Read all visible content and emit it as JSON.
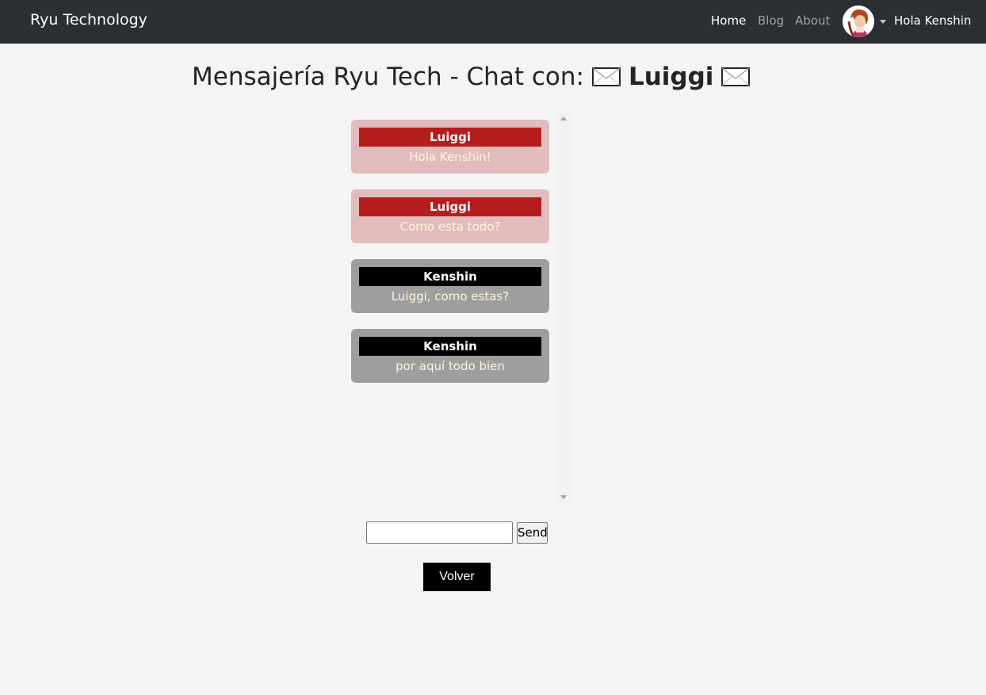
{
  "navbar": {
    "brand": "Ryu Technology",
    "links": [
      {
        "label": "Home",
        "active": true
      },
      {
        "label": "Blog",
        "active": false
      },
      {
        "label": "About",
        "active": false
      }
    ],
    "user_menu": {
      "avatar_icon": "user-avatar",
      "caret_icon": "caret-down-icon",
      "greeting": "Hola Kenshin"
    }
  },
  "page": {
    "title_prefix": "Mensajería Ryu Tech - Chat con:",
    "contact_name": "Luiggi",
    "title_icon": "envelope-icon"
  },
  "messages": [
    {
      "sender": "Luiggi",
      "text": "Hola Kenshin!",
      "from_me": false
    },
    {
      "sender": "Luiggi",
      "text": "Como esta todo?",
      "from_me": false
    },
    {
      "sender": "Kenshin",
      "text": "Luiggi, como estas?",
      "from_me": true
    },
    {
      "sender": "Kenshin",
      "text": "por aquí todo bien",
      "from_me": true
    }
  ],
  "composer": {
    "input_value": "",
    "send_label": "Send"
  },
  "back_label": "Volver",
  "colors": {
    "navbar_bg": "#2b2f33",
    "page_bg": "#f4f4f4",
    "other_bubble_bg": "#e2bcbc",
    "other_header_bg": "#b51d1d",
    "my_bubble_bg": "#9e9e9e",
    "my_header_bg": "#000000",
    "bubble_text": "#fff4dc"
  }
}
